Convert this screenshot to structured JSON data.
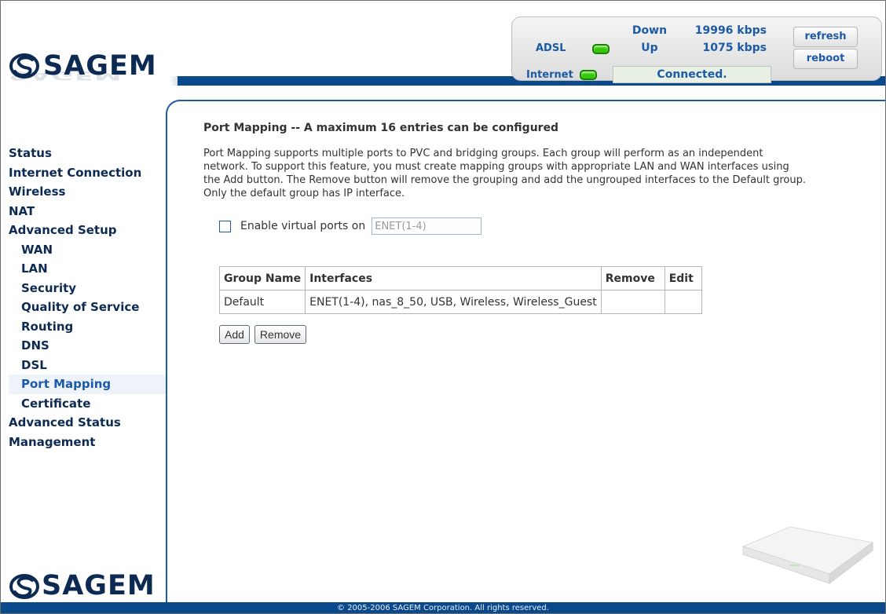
{
  "brand": {
    "logo_text": "SAGEM"
  },
  "status_panel": {
    "adsl_label": "ADSL",
    "internet_label": "Internet",
    "down_label": "Down",
    "down_value": "19996 kbps",
    "up_label": "Up",
    "up_value": "1075 kbps",
    "connection_status": "Connected.",
    "refresh_label": "refresh",
    "reboot_label": "reboot",
    "led_color": "#34c70c"
  },
  "sidebar": {
    "items": [
      {
        "label": "Status"
      },
      {
        "label": "Internet Connection"
      },
      {
        "label": "Wireless"
      },
      {
        "label": "NAT"
      },
      {
        "label": "Advanced Setup"
      },
      {
        "label": "WAN"
      },
      {
        "label": "LAN"
      },
      {
        "label": "Security"
      },
      {
        "label": "Quality of Service"
      },
      {
        "label": "Routing"
      },
      {
        "label": "DNS"
      },
      {
        "label": "DSL"
      },
      {
        "label": "Port Mapping"
      },
      {
        "label": "Certificate"
      },
      {
        "label": "Advanced Status"
      },
      {
        "label": "Management"
      }
    ],
    "active": "Port Mapping"
  },
  "main": {
    "title": "Port Mapping -- A maximum 16 entries can be configured",
    "description": "Port Mapping supports multiple ports to PVC and bridging groups. Each group will perform as an independent network. To support this feature, you must create mapping groups with appropriate LAN and WAN interfaces using the Add button. The Remove button will remove the grouping and add the ungrouped interfaces to the Default group. Only the default group has IP interface.",
    "virtual_ports": {
      "label": "Enable virtual ports on",
      "value": "ENET(1-4)",
      "checked": false
    },
    "table": {
      "headers": [
        "Group Name",
        "Interfaces",
        "Remove",
        "Edit"
      ],
      "rows": [
        {
          "group_name": "Default",
          "interfaces": "ENET(1-4), nas_8_50, USB, Wireless, Wireless_Guest",
          "remove": "",
          "edit": ""
        }
      ]
    },
    "add_label": "Add",
    "remove_label": "Remove"
  },
  "footer": {
    "copyright": "© 2005-2006 SAGEM Corporation. All rights reserved."
  },
  "colors": {
    "brand_navy": "#0c2a52",
    "accent_blue": "#1c5aa6",
    "band_blue": "#0a4a8c"
  }
}
